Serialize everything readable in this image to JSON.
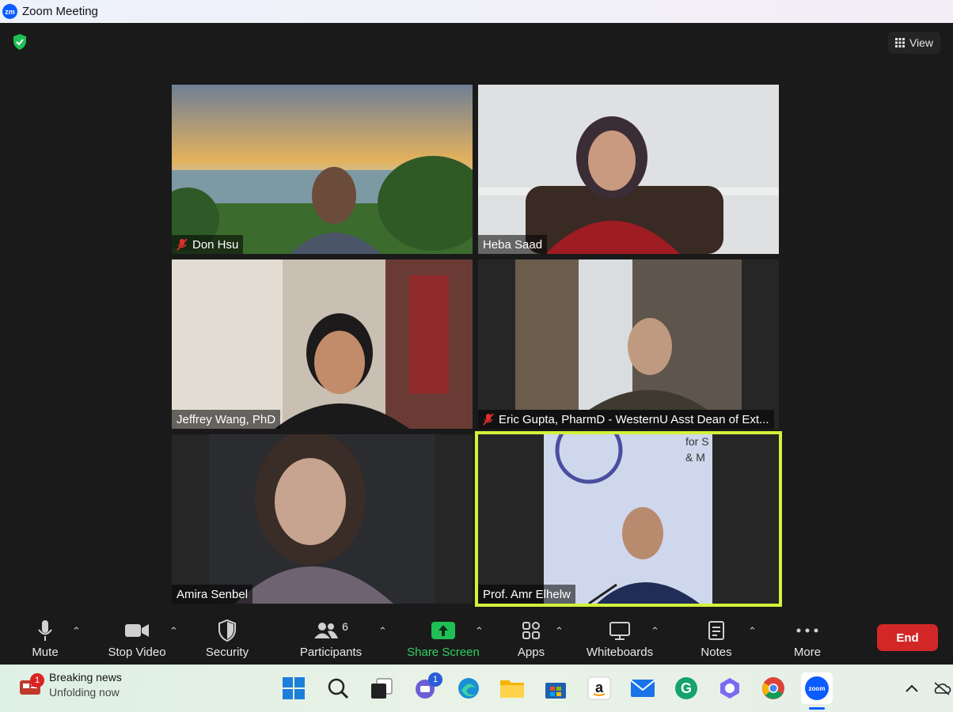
{
  "window": {
    "title": "Zoom Meeting",
    "app_icon_text": "zm"
  },
  "header": {
    "view_label": "View"
  },
  "participants_grid": [
    {
      "name": "Don Hsu",
      "muted": true
    },
    {
      "name": "Heba Saad",
      "muted": false
    },
    {
      "name": "Jeffrey Wang, PhD",
      "muted": false
    },
    {
      "name": "Eric Gupta, PharmD - WesternU Asst Dean of Ext...",
      "muted": true
    },
    {
      "name": "Amira Senbel",
      "muted": false
    },
    {
      "name": "Prof. Amr Elhelw",
      "muted": false,
      "active_speaker": true
    }
  ],
  "toolbar": {
    "mute": "Mute",
    "stop_video": "Stop Video",
    "security": "Security",
    "participants": "Participants",
    "participants_count": "6",
    "share_screen": "Share Screen",
    "apps": "Apps",
    "whiteboards": "Whiteboards",
    "notes": "Notes",
    "more": "More",
    "end": "End"
  },
  "taskbar": {
    "news_title": "Breaking news",
    "news_subtitle": "Unfolding now",
    "news_badge": "1",
    "chat_badge": "1",
    "zoom_icon_text": "zoom"
  },
  "colors": {
    "accent_green": "#1fbf55",
    "end_red": "#d32727",
    "active_speaker_border": "#d2f23b",
    "zoom_blue": "#0b5cff"
  }
}
